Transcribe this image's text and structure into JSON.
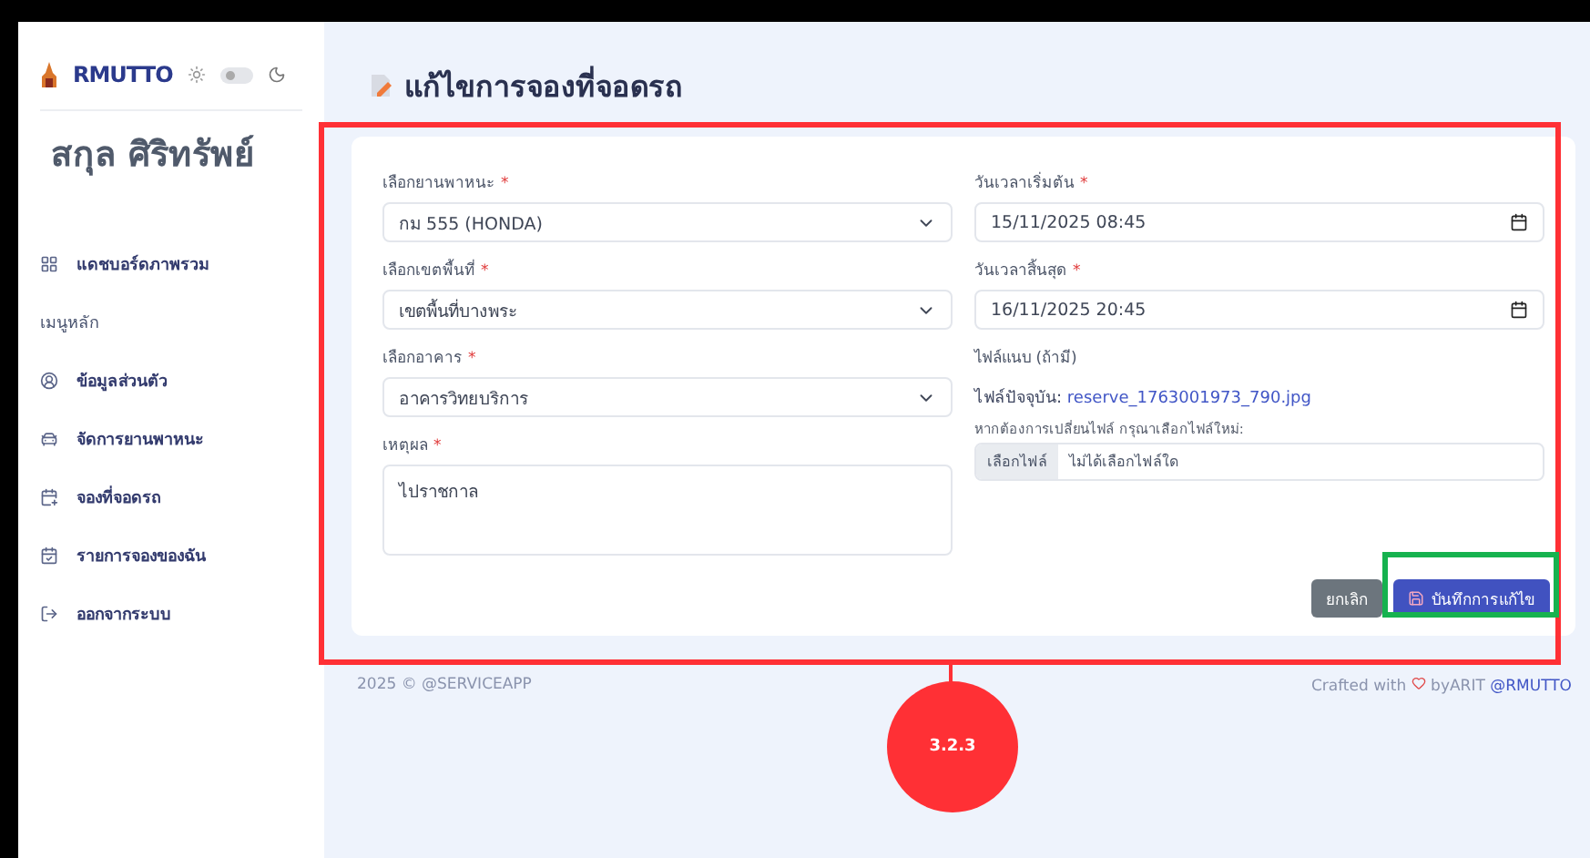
{
  "sidebar": {
    "logo": "RMUTTO",
    "dark_mode": {
      "on": false
    },
    "user_name": "สกุล ศิริทรัพย์",
    "items": [
      {
        "kind": "link",
        "label": "แดชบอร์ดภาพรวม"
      },
      {
        "kind": "section",
        "label": "เมนูหลัก"
      },
      {
        "kind": "link",
        "label": "ข้อมูลส่วนตัว"
      },
      {
        "kind": "link",
        "label": "จัดการยานพาหนะ"
      },
      {
        "kind": "link",
        "label": "จองที่จอดรถ"
      },
      {
        "kind": "link",
        "label": "รายการจองของฉัน"
      },
      {
        "kind": "link",
        "label": "ออกจากระบบ"
      }
    ]
  },
  "page_title": "แก้ไขการจองที่จอดรถ",
  "form": {
    "required_mark": "*",
    "left": [
      {
        "kind": "select",
        "label": "เลือกยานพาหนะ",
        "required": true,
        "value": "กม 555 (HONDA)"
      },
      {
        "kind": "select",
        "label": "เลือกเขตพื้นที่",
        "required": true,
        "value": "เขตพื้นที่บางพระ"
      },
      {
        "kind": "select",
        "label": "เลือกอาคาร",
        "required": true,
        "value": "อาคารวิทยบริการ"
      },
      {
        "kind": "textarea",
        "label": "เหตุผล",
        "required": true,
        "value": "ไปราชกาล"
      }
    ],
    "right": [
      {
        "kind": "datetime",
        "label": "วันเวลาเริ่มต้น",
        "required": true,
        "value": "15/11/2025 08:45"
      },
      {
        "kind": "datetime",
        "label": "วันเวลาสิ้นสุด",
        "required": true,
        "value": "16/11/2025 20:45"
      },
      {
        "kind": "file",
        "label": "ไฟล์แนบ (ถ้ามี)",
        "required": false,
        "current_label": "ไฟล์ปัจจุบัน:",
        "current_file": "reserve_1763001973_790.jpg",
        "hint": "หากต้องการเปลี่ยนไฟล์ กรุณาเลือกไฟล์ใหม่:",
        "button": "เลือกไฟล์",
        "status": "ไม่ได้เลือกไฟล์ใด"
      }
    ],
    "buttons": [
      {
        "kind": "cancel",
        "label": "ยกเลิก"
      },
      {
        "kind": "save",
        "label": "บันทึกการแก้ไข"
      }
    ]
  },
  "footer": {
    "left": "2025 © @SERVICEAPP",
    "right_prefix": "Crafted with",
    "right_by": "byARIT",
    "right_link": "@RMUTTO"
  },
  "annotation": {
    "label": "3.2.3"
  }
}
